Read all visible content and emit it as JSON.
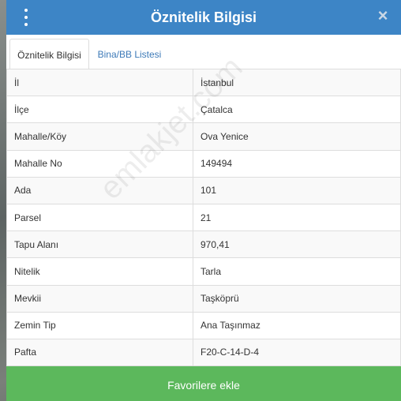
{
  "header": {
    "title": "Öznitelik Bilgisi",
    "menu_icon": "vertical-ellipsis-icon",
    "close_icon": "close-icon",
    "color": "#3d85c6"
  },
  "tabs": [
    {
      "label": "Öznitelik Bilgisi",
      "active": true
    },
    {
      "label": "Bina/BB Listesi",
      "active": false
    }
  ],
  "attributes": [
    {
      "key": "İl",
      "value": "İstanbul"
    },
    {
      "key": "İlçe",
      "value": "Çatalca"
    },
    {
      "key": "Mahalle/Köy",
      "value": "Ova Yenice"
    },
    {
      "key": "Mahalle No",
      "value": "149494"
    },
    {
      "key": "Ada",
      "value": "101"
    },
    {
      "key": "Parsel",
      "value": "21"
    },
    {
      "key": "Tapu Alanı",
      "value": "970,41"
    },
    {
      "key": "Nitelik",
      "value": "Tarla"
    },
    {
      "key": "Mevkii",
      "value": "Taşköprü"
    },
    {
      "key": "Zemin Tip",
      "value": "Ana Taşınmaz"
    },
    {
      "key": "Pafta",
      "value": "F20-C-14-D-4"
    }
  ],
  "watermark": "emlakjet.com",
  "footer": {
    "button_label": "Favorilere ekle",
    "color": "#5cb85c"
  }
}
